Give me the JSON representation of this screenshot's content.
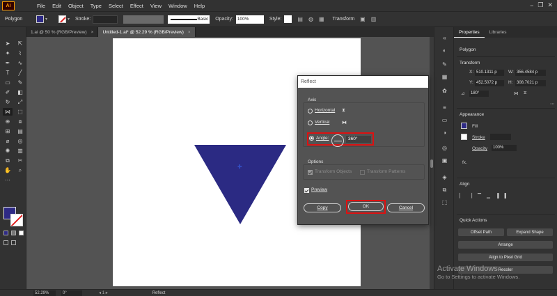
{
  "app": {
    "logo": "Ai"
  },
  "menu": [
    "File",
    "Edit",
    "Object",
    "Type",
    "Select",
    "Effect",
    "View",
    "Window",
    "Help"
  ],
  "window_controls": [
    "−",
    "❐",
    "✕"
  ],
  "controlbar": {
    "selection": "Polygon",
    "stroke_label": "Stroke:",
    "brush": "Basic",
    "opacity_label": "Opacity:",
    "opacity_value": "100%",
    "style_label": "Style:",
    "transform": "Transform",
    "fill_color": "#2e2a85"
  },
  "tabs": [
    {
      "label": "1.ai @ 50 % (RGB/Preview)",
      "close": "×"
    },
    {
      "label": "Untitled-1.ai* @ 52.29 % (RGB/Preview)",
      "close": "×"
    }
  ],
  "panel": {
    "tabs": [
      "Properties",
      "Libraries"
    ],
    "selection": "Polygon",
    "transform": {
      "title": "Transform",
      "x_label": "X:",
      "x": "510.1311 p",
      "y_label": "Y:",
      "y": "452.5072 p",
      "w_label": "W:",
      "w": "356.4584 p",
      "h_label": "H:",
      "h": "308.7021 p",
      "angle": "180°"
    },
    "appearance": {
      "title": "Appearance",
      "fill": "Fill",
      "stroke": "Stroke",
      "opacity": "Opacity",
      "opacity_value": "100%",
      "fx": "fx."
    },
    "align": {
      "title": "Align"
    },
    "quick_actions": {
      "title": "Quick Actions",
      "offset_path": "Offset Path",
      "expand_shape": "Expand Shape",
      "arrange": "Arrange",
      "align_pixel": "Align to Pixel Grid",
      "recolor": "Recolor"
    }
  },
  "dialog": {
    "title": "Reflect",
    "axis": "Axis",
    "horizontal": "Horizontal",
    "vertical": "Vertical",
    "angle_label": "Angle:",
    "angle_value": "360°",
    "options": "Options",
    "transform_objects": "Transform Objects",
    "transform_patterns": "Transform Patterns",
    "preview": "Preview",
    "copy": "Copy",
    "ok": "OK",
    "cancel": "Cancel",
    "highlight_color": "#d11111"
  },
  "status": {
    "zoom": "52.29%",
    "rotation": "0°",
    "page": "1",
    "tool": "Reflect"
  },
  "watermark": {
    "line1": "Activate Windows",
    "line2": "Go to Settings to activate Windows."
  }
}
